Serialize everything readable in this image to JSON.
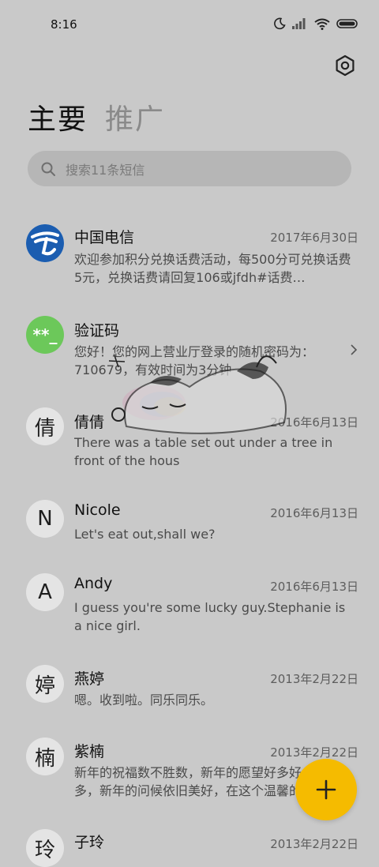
{
  "status": {
    "time": "8:16"
  },
  "tabs": {
    "primary": "主要",
    "promo": "推广"
  },
  "search": {
    "placeholder": "搜索11条短信"
  },
  "colors": {
    "fab": "#f5bb00",
    "telecom": "#1b5db0",
    "verify": "#6cc85a"
  },
  "messages": [
    {
      "name": "中国电信",
      "date": "2017年6月30日",
      "preview": "欢迎参加积分兑换话费活动，每500分可兑换话费5元，兑换话费请回复106或jfdh#话费…",
      "avatar": "telecom-logo"
    },
    {
      "name": "验证码",
      "date": "",
      "preview": "您好！您的网上营业厅登录的随机密码为：710679，有效时间为3分钟",
      "avatar_text": "**_"
    },
    {
      "name": "倩倩",
      "date": "2016年6月13日",
      "preview": "There was a table set out under a tree in front of the hous",
      "avatar_text": "倩"
    },
    {
      "name": "Nicole",
      "date": "2016年6月13日",
      "preview": "Let's eat out,shall we?",
      "avatar_text": "N"
    },
    {
      "name": "Andy",
      "date": "2016年6月13日",
      "preview": "I guess you're some lucky guy.Stephanie is a nice girl.",
      "avatar_text": "A"
    },
    {
      "name": "燕婷",
      "date": "2013年2月22日",
      "preview": "嗯。收到啦。同乐同乐。",
      "avatar_text": "婷"
    },
    {
      "name": "紫楠",
      "date": "2013年2月22日",
      "preview": "新年的祝福数不胜数，新年的愿望好多好多，新年的问候依旧美好，在这个温馨的",
      "avatar_text": "楠"
    },
    {
      "name": "子玲",
      "date": "2013年2月22日",
      "preview": "",
      "avatar_text": "玲"
    }
  ]
}
